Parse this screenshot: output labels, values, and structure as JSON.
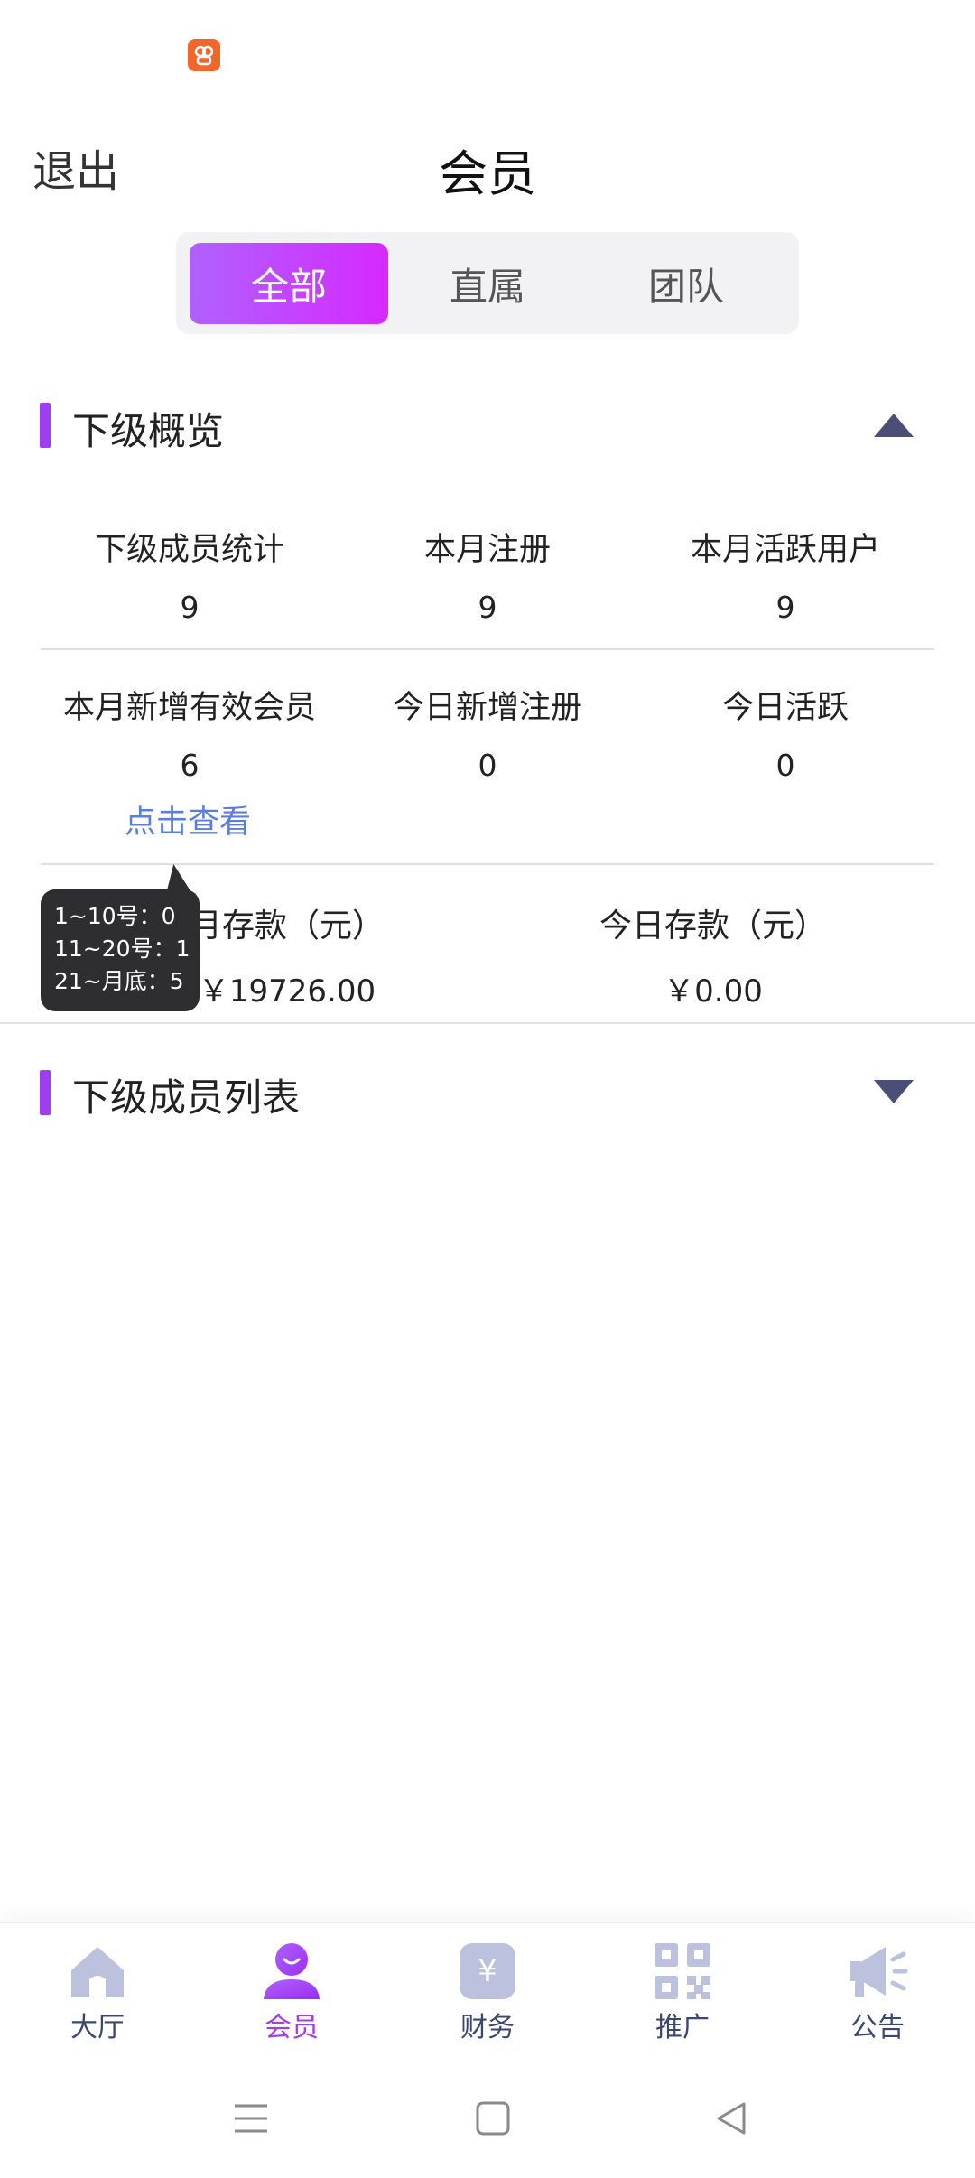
{
  "status_bar": {
    "app_icon": "app-notification-icon"
  },
  "header": {
    "back_label": "退出",
    "title": "会员"
  },
  "tabs": [
    {
      "label": "全部",
      "active": true
    },
    {
      "label": "直属",
      "active": false
    },
    {
      "label": "团队",
      "active": false
    }
  ],
  "overview": {
    "title": "下级概览",
    "toggle_icon": "triangle-up-icon",
    "row1": [
      {
        "label": "下级成员统计",
        "value": "9"
      },
      {
        "label": "本月注册",
        "value": "9"
      },
      {
        "label": "本月活跃用户",
        "value": "9"
      }
    ],
    "row2": [
      {
        "label": "本月新增有效会员",
        "value": "6"
      },
      {
        "label": "今日新增注册",
        "value": "0"
      },
      {
        "label": "今日活跃",
        "value": "0"
      }
    ],
    "view_link": "点击查看",
    "deposit": [
      {
        "label": "月存款（元）",
        "value": "￥19726.00"
      },
      {
        "label": "今日存款（元）",
        "value": "￥0.00"
      }
    ]
  },
  "tooltip": {
    "lines": [
      "1~10号：0",
      "11~20号：1",
      "21~月底：5"
    ]
  },
  "members": {
    "title": "下级成员列表",
    "toggle_icon": "triangle-down-icon"
  },
  "bottom_nav": [
    {
      "label": "大厅",
      "icon": "home-icon",
      "active": false
    },
    {
      "label": "会员",
      "icon": "member-icon",
      "active": true
    },
    {
      "label": "财务",
      "icon": "finance-icon",
      "active": false
    },
    {
      "label": "推广",
      "icon": "qr-code-icon",
      "active": false
    },
    {
      "label": "公告",
      "icon": "megaphone-icon",
      "active": false
    }
  ],
  "colors": {
    "accent": "#a03cf2",
    "link": "#5c7de0",
    "nav_text": "#3b4773",
    "icon_gray": "#bcc2dd"
  }
}
